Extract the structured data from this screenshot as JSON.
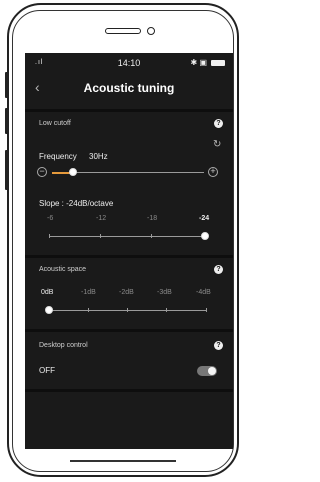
{
  "status_bar": {
    "signal": ".ıl",
    "wifi": "wifi-icon",
    "time": "14:10",
    "right_icons": "✱ ▣"
  },
  "nav": {
    "back": "‹",
    "title": "Acoustic tuning"
  },
  "low_cutoff": {
    "header": "Low cutoff",
    "help": "?",
    "frequency_label": "Frequency",
    "frequency_value": "30Hz",
    "minus": "−",
    "plus": "+",
    "frequency_level": 0.14,
    "slope_label": "Slope : -24dB/octave",
    "slope_options": [
      "-6",
      "-12",
      "-18",
      "-24"
    ],
    "slope_selected": "-24"
  },
  "acoustic_space": {
    "header": "Acoustic space",
    "help": "?",
    "options": [
      "0dB",
      "-1dB",
      "-2dB",
      "-3dB",
      "-4dB"
    ],
    "selected": "0dB"
  },
  "desktop_control": {
    "header": "Desktop control",
    "help": "?",
    "state": "OFF"
  },
  "colors": {
    "accent": "#e59a3c",
    "screen_bg": "#1a1a1a"
  }
}
